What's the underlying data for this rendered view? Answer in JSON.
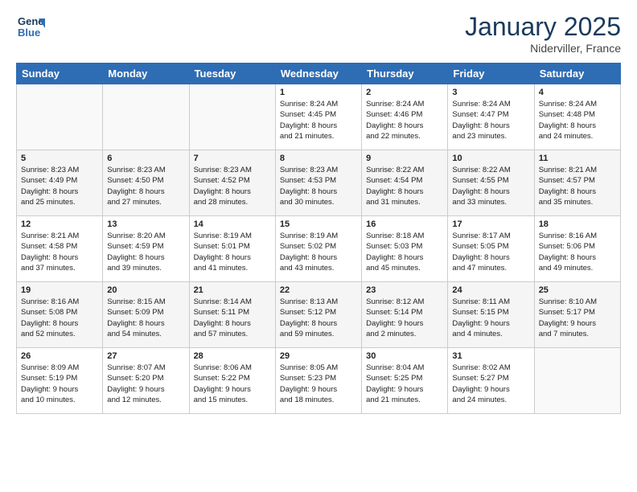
{
  "header": {
    "logo_line1": "General",
    "logo_line2": "Blue",
    "month": "January 2025",
    "location": "Niderviller, France"
  },
  "weekdays": [
    "Sunday",
    "Monday",
    "Tuesday",
    "Wednesday",
    "Thursday",
    "Friday",
    "Saturday"
  ],
  "weeks": [
    [
      {
        "day": "",
        "info": ""
      },
      {
        "day": "",
        "info": ""
      },
      {
        "day": "",
        "info": ""
      },
      {
        "day": "1",
        "info": "Sunrise: 8:24 AM\nSunset: 4:45 PM\nDaylight: 8 hours\nand 21 minutes."
      },
      {
        "day": "2",
        "info": "Sunrise: 8:24 AM\nSunset: 4:46 PM\nDaylight: 8 hours\nand 22 minutes."
      },
      {
        "day": "3",
        "info": "Sunrise: 8:24 AM\nSunset: 4:47 PM\nDaylight: 8 hours\nand 23 minutes."
      },
      {
        "day": "4",
        "info": "Sunrise: 8:24 AM\nSunset: 4:48 PM\nDaylight: 8 hours\nand 24 minutes."
      }
    ],
    [
      {
        "day": "5",
        "info": "Sunrise: 8:23 AM\nSunset: 4:49 PM\nDaylight: 8 hours\nand 25 minutes."
      },
      {
        "day": "6",
        "info": "Sunrise: 8:23 AM\nSunset: 4:50 PM\nDaylight: 8 hours\nand 27 minutes."
      },
      {
        "day": "7",
        "info": "Sunrise: 8:23 AM\nSunset: 4:52 PM\nDaylight: 8 hours\nand 28 minutes."
      },
      {
        "day": "8",
        "info": "Sunrise: 8:23 AM\nSunset: 4:53 PM\nDaylight: 8 hours\nand 30 minutes."
      },
      {
        "day": "9",
        "info": "Sunrise: 8:22 AM\nSunset: 4:54 PM\nDaylight: 8 hours\nand 31 minutes."
      },
      {
        "day": "10",
        "info": "Sunrise: 8:22 AM\nSunset: 4:55 PM\nDaylight: 8 hours\nand 33 minutes."
      },
      {
        "day": "11",
        "info": "Sunrise: 8:21 AM\nSunset: 4:57 PM\nDaylight: 8 hours\nand 35 minutes."
      }
    ],
    [
      {
        "day": "12",
        "info": "Sunrise: 8:21 AM\nSunset: 4:58 PM\nDaylight: 8 hours\nand 37 minutes."
      },
      {
        "day": "13",
        "info": "Sunrise: 8:20 AM\nSunset: 4:59 PM\nDaylight: 8 hours\nand 39 minutes."
      },
      {
        "day": "14",
        "info": "Sunrise: 8:19 AM\nSunset: 5:01 PM\nDaylight: 8 hours\nand 41 minutes."
      },
      {
        "day": "15",
        "info": "Sunrise: 8:19 AM\nSunset: 5:02 PM\nDaylight: 8 hours\nand 43 minutes."
      },
      {
        "day": "16",
        "info": "Sunrise: 8:18 AM\nSunset: 5:03 PM\nDaylight: 8 hours\nand 45 minutes."
      },
      {
        "day": "17",
        "info": "Sunrise: 8:17 AM\nSunset: 5:05 PM\nDaylight: 8 hours\nand 47 minutes."
      },
      {
        "day": "18",
        "info": "Sunrise: 8:16 AM\nSunset: 5:06 PM\nDaylight: 8 hours\nand 49 minutes."
      }
    ],
    [
      {
        "day": "19",
        "info": "Sunrise: 8:16 AM\nSunset: 5:08 PM\nDaylight: 8 hours\nand 52 minutes."
      },
      {
        "day": "20",
        "info": "Sunrise: 8:15 AM\nSunset: 5:09 PM\nDaylight: 8 hours\nand 54 minutes."
      },
      {
        "day": "21",
        "info": "Sunrise: 8:14 AM\nSunset: 5:11 PM\nDaylight: 8 hours\nand 57 minutes."
      },
      {
        "day": "22",
        "info": "Sunrise: 8:13 AM\nSunset: 5:12 PM\nDaylight: 8 hours\nand 59 minutes."
      },
      {
        "day": "23",
        "info": "Sunrise: 8:12 AM\nSunset: 5:14 PM\nDaylight: 9 hours\nand 2 minutes."
      },
      {
        "day": "24",
        "info": "Sunrise: 8:11 AM\nSunset: 5:15 PM\nDaylight: 9 hours\nand 4 minutes."
      },
      {
        "day": "25",
        "info": "Sunrise: 8:10 AM\nSunset: 5:17 PM\nDaylight: 9 hours\nand 7 minutes."
      }
    ],
    [
      {
        "day": "26",
        "info": "Sunrise: 8:09 AM\nSunset: 5:19 PM\nDaylight: 9 hours\nand 10 minutes."
      },
      {
        "day": "27",
        "info": "Sunrise: 8:07 AM\nSunset: 5:20 PM\nDaylight: 9 hours\nand 12 minutes."
      },
      {
        "day": "28",
        "info": "Sunrise: 8:06 AM\nSunset: 5:22 PM\nDaylight: 9 hours\nand 15 minutes."
      },
      {
        "day": "29",
        "info": "Sunrise: 8:05 AM\nSunset: 5:23 PM\nDaylight: 9 hours\nand 18 minutes."
      },
      {
        "day": "30",
        "info": "Sunrise: 8:04 AM\nSunset: 5:25 PM\nDaylight: 9 hours\nand 21 minutes."
      },
      {
        "day": "31",
        "info": "Sunrise: 8:02 AM\nSunset: 5:27 PM\nDaylight: 9 hours\nand 24 minutes."
      },
      {
        "day": "",
        "info": ""
      }
    ]
  ]
}
